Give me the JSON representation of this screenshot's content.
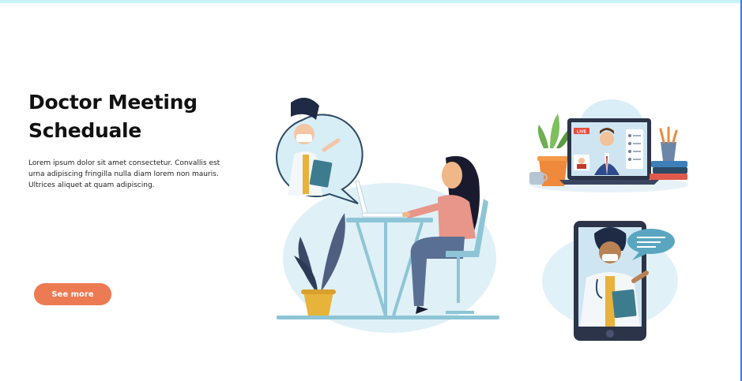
{
  "hero": {
    "title_line1": "Doctor Meeting",
    "title_line2": "Scheduale",
    "description": "Lorem ipsum dolor sit amet consectetur. Convallis est urna adipiscing fringilla nulla diam lorem non mauris. Ultrices aliquet at quam adipiscing.",
    "cta_label": "See more"
  },
  "laptop_badge": "LIVE",
  "colors": {
    "accent": "#ec7a52",
    "top_bar": "#c9f3f6",
    "illustration_blue": "#8ec5d6",
    "illustration_light": "#d9eef6"
  },
  "icons": [
    "doctor-illustration",
    "woman-at-desk-illustration",
    "laptop-video-call-illustration",
    "tablet-doctor-illustration"
  ]
}
